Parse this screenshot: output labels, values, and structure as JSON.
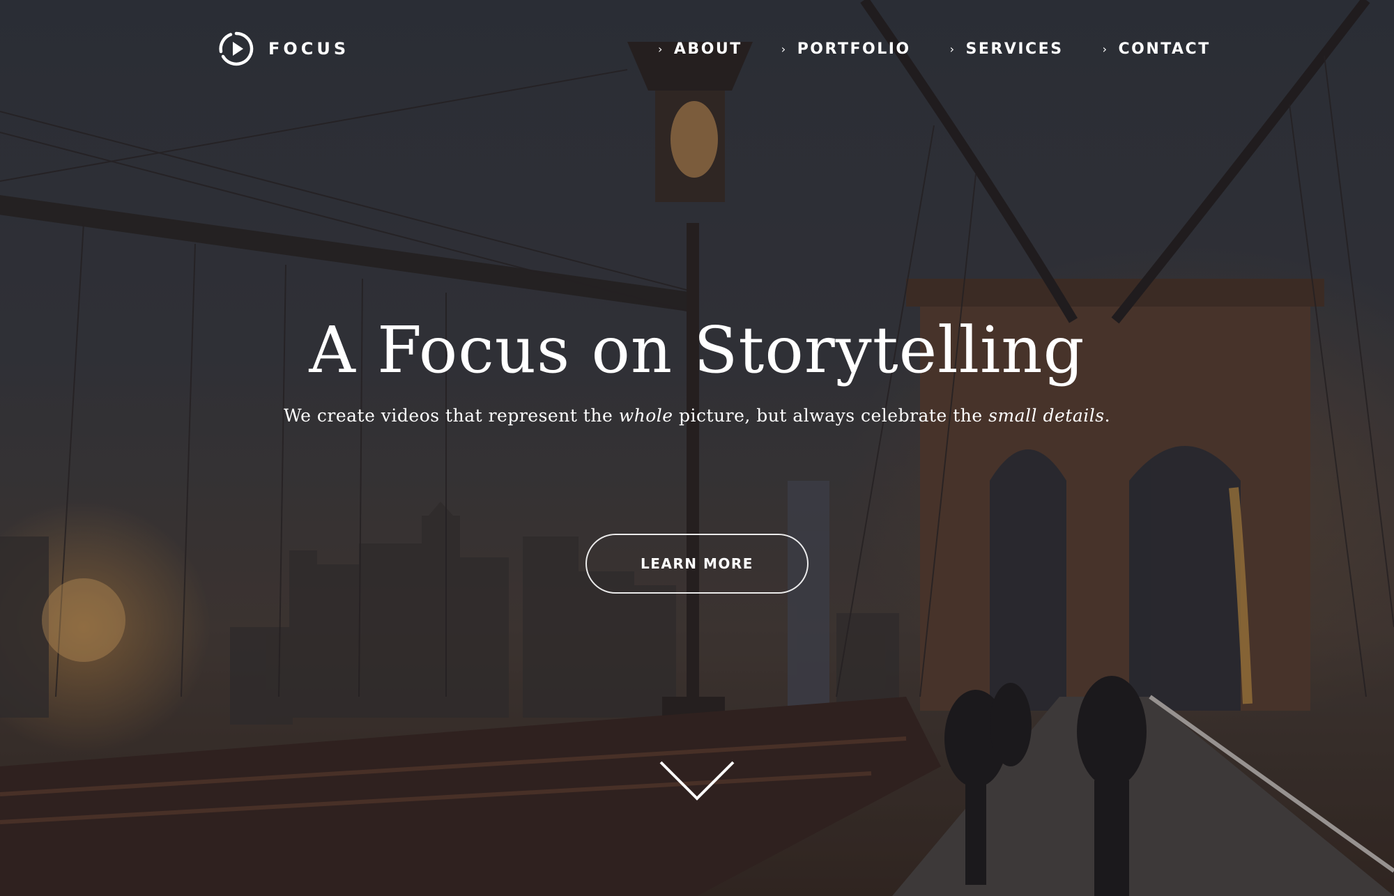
{
  "brand": {
    "name": "FOCUS",
    "logo_icon": "play-circle-icon"
  },
  "nav": {
    "items": [
      {
        "label": "ABOUT",
        "icon": "chevron-right-icon"
      },
      {
        "label": "PORTFOLIO",
        "icon": "chevron-right-icon"
      },
      {
        "label": "SERVICES",
        "icon": "chevron-right-icon"
      },
      {
        "label": "CONTACT",
        "icon": "chevron-right-icon"
      }
    ]
  },
  "hero": {
    "headline": "A Focus on Storytelling",
    "subline": {
      "part1": "We create videos that represent the ",
      "emph1": "whole",
      "part2": " picture,  but always celebrate the ",
      "emph2": "small details",
      "part3": "."
    },
    "cta_label": "LEARN MORE",
    "scroll_icon": "chevron-down-icon"
  },
  "colors": {
    "text": "#ffffff",
    "overlay": "#1e2128"
  }
}
